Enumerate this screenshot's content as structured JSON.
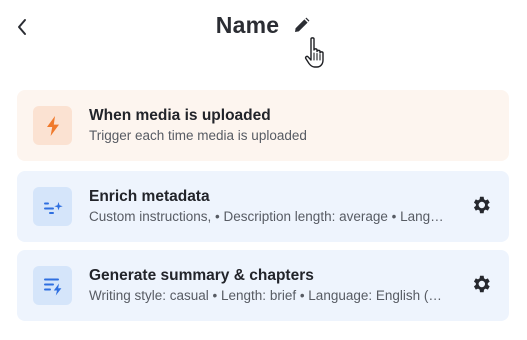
{
  "header": {
    "title": "Name",
    "back_icon": "chevron-left-icon",
    "edit_icon": "pencil-icon"
  },
  "trigger": {
    "title": "When media is uploaded",
    "subtitle": "Trigger each time media is uploaded",
    "icon": "lightning-bolt-icon",
    "accent": "#f07a2c"
  },
  "steps": [
    {
      "title": "Enrich metadata",
      "subtitle": "Custom instructions, • Description length: average • Language: English",
      "icon": "sparkle-list-icon",
      "settings_icon": "gear-icon"
    },
    {
      "title": "Generate summary & chapters",
      "subtitle": "Writing style: casual • Length: brief • Language: English (US)",
      "icon": "lines-sparkle-icon",
      "settings_icon": "gear-icon"
    }
  ],
  "colors": {
    "step_accent": "#2f6fe0",
    "trigger_bg": "#fdf5ef",
    "step_bg": "#eef4fd"
  }
}
